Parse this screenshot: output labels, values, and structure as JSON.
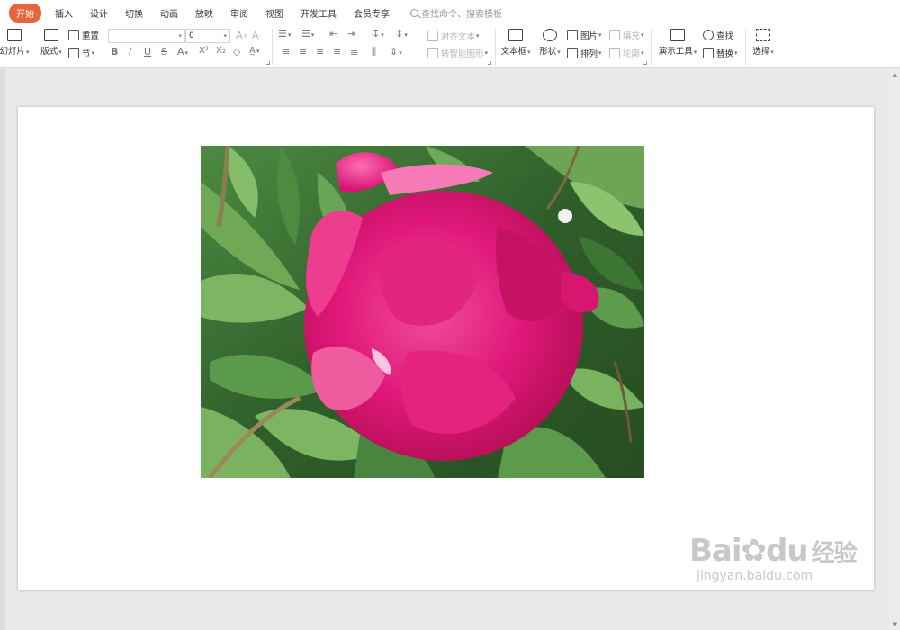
{
  "menu": {
    "tabs": [
      "开始",
      "插入",
      "设计",
      "切换",
      "动画",
      "放映",
      "审阅",
      "视图",
      "开发工具",
      "会员专享"
    ],
    "active_index": 0,
    "search_placeholder": "查找命令、搜索模板"
  },
  "ribbon": {
    "new_slide": "幻灯片",
    "layout": "版式",
    "reset": "重置",
    "section": "节",
    "font_name": "",
    "font_size": "0",
    "align_text": "对齐文本",
    "smartart": "转智能图形",
    "textbox": "文本框",
    "shape": "形状",
    "picture": "图片",
    "fill": "填充",
    "arrange": "排列",
    "outline": "轮廓",
    "presentation_tools": "演示工具",
    "find": "查找",
    "replace": "替换",
    "select": "选择"
  },
  "watermark": {
    "logo_latin": "Bai",
    "logo_du": "du",
    "logo_cn": "经验",
    "url": "jingyan.baidu.com"
  },
  "colors": {
    "active_tab": "#e8643c",
    "workspace_bg": "#e9e9eb",
    "flower": "#e01a73",
    "leaf": "#3e7a36"
  }
}
